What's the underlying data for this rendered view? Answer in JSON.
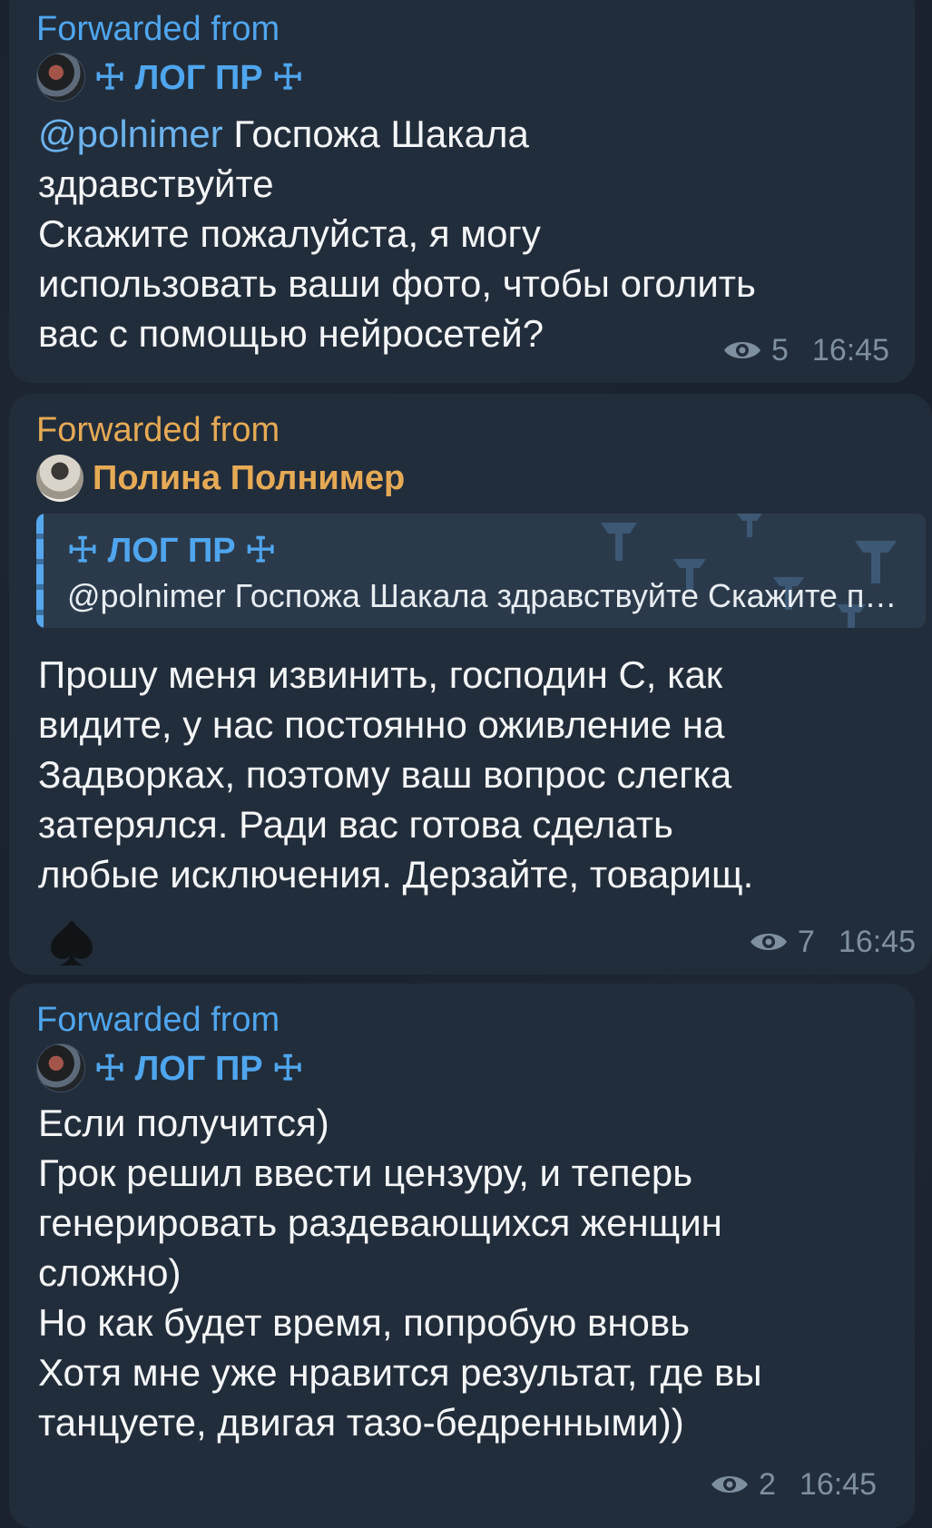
{
  "colors": {
    "background": "#1a2230",
    "bubble": "#222d3b",
    "forward_label": "#e6aa55",
    "log_pr": "#4fa6ee",
    "polina": "#e6aa55",
    "mention": "#6cb3ee",
    "meta": "#7e8fa0"
  },
  "messages": [
    {
      "forwarded_label": "Forwarded from",
      "source_name": "☩ ЛОГ ПР ☩",
      "source_avatar": "log-pr-avatar",
      "mention": "@polnimer",
      "text_after_mention": " Госпожа Шакала\nздравствуйте\nСкажите пожалуйста, я могу\nиспользовать ваши фото, чтобы оголить\nвас с помощью нейросетей?",
      "views": "5",
      "time": "16:45"
    },
    {
      "forwarded_label": "Forwarded from",
      "source_name": "Полина Полнимер",
      "source_avatar": "polina-avatar",
      "quote_title": "☩ ЛОГ ПР ☩",
      "quote_text": "@polnimer Госпожа Шакала здравствуйте Скажите пожалуйста",
      "text": "Прошу меня извинить, господин С, как\nвидите, у нас постоянно оживление на\nЗадворках, поэтому ваш вопрос слегка\nзатерялся. Ради вас готова сделать\nлюбые исключения. Дерзайте, товарищ.",
      "signature_icon": "spade-icon",
      "views": "7",
      "time": "16:45"
    },
    {
      "forwarded_label": "Forwarded from",
      "source_name": "☩ ЛОГ ПР ☩",
      "source_avatar": "log-pr-avatar",
      "text": "Если получится)\nГрок решил ввести цензуру, и теперь\nгенерировать раздевающихся женщин\nсложно)\nНо как будет время, попробую вновь\nХотя мне уже нравится результат, где вы\nтанцуете, двигая тазо-бедренными))",
      "views": "2",
      "time": "16:45"
    }
  ]
}
